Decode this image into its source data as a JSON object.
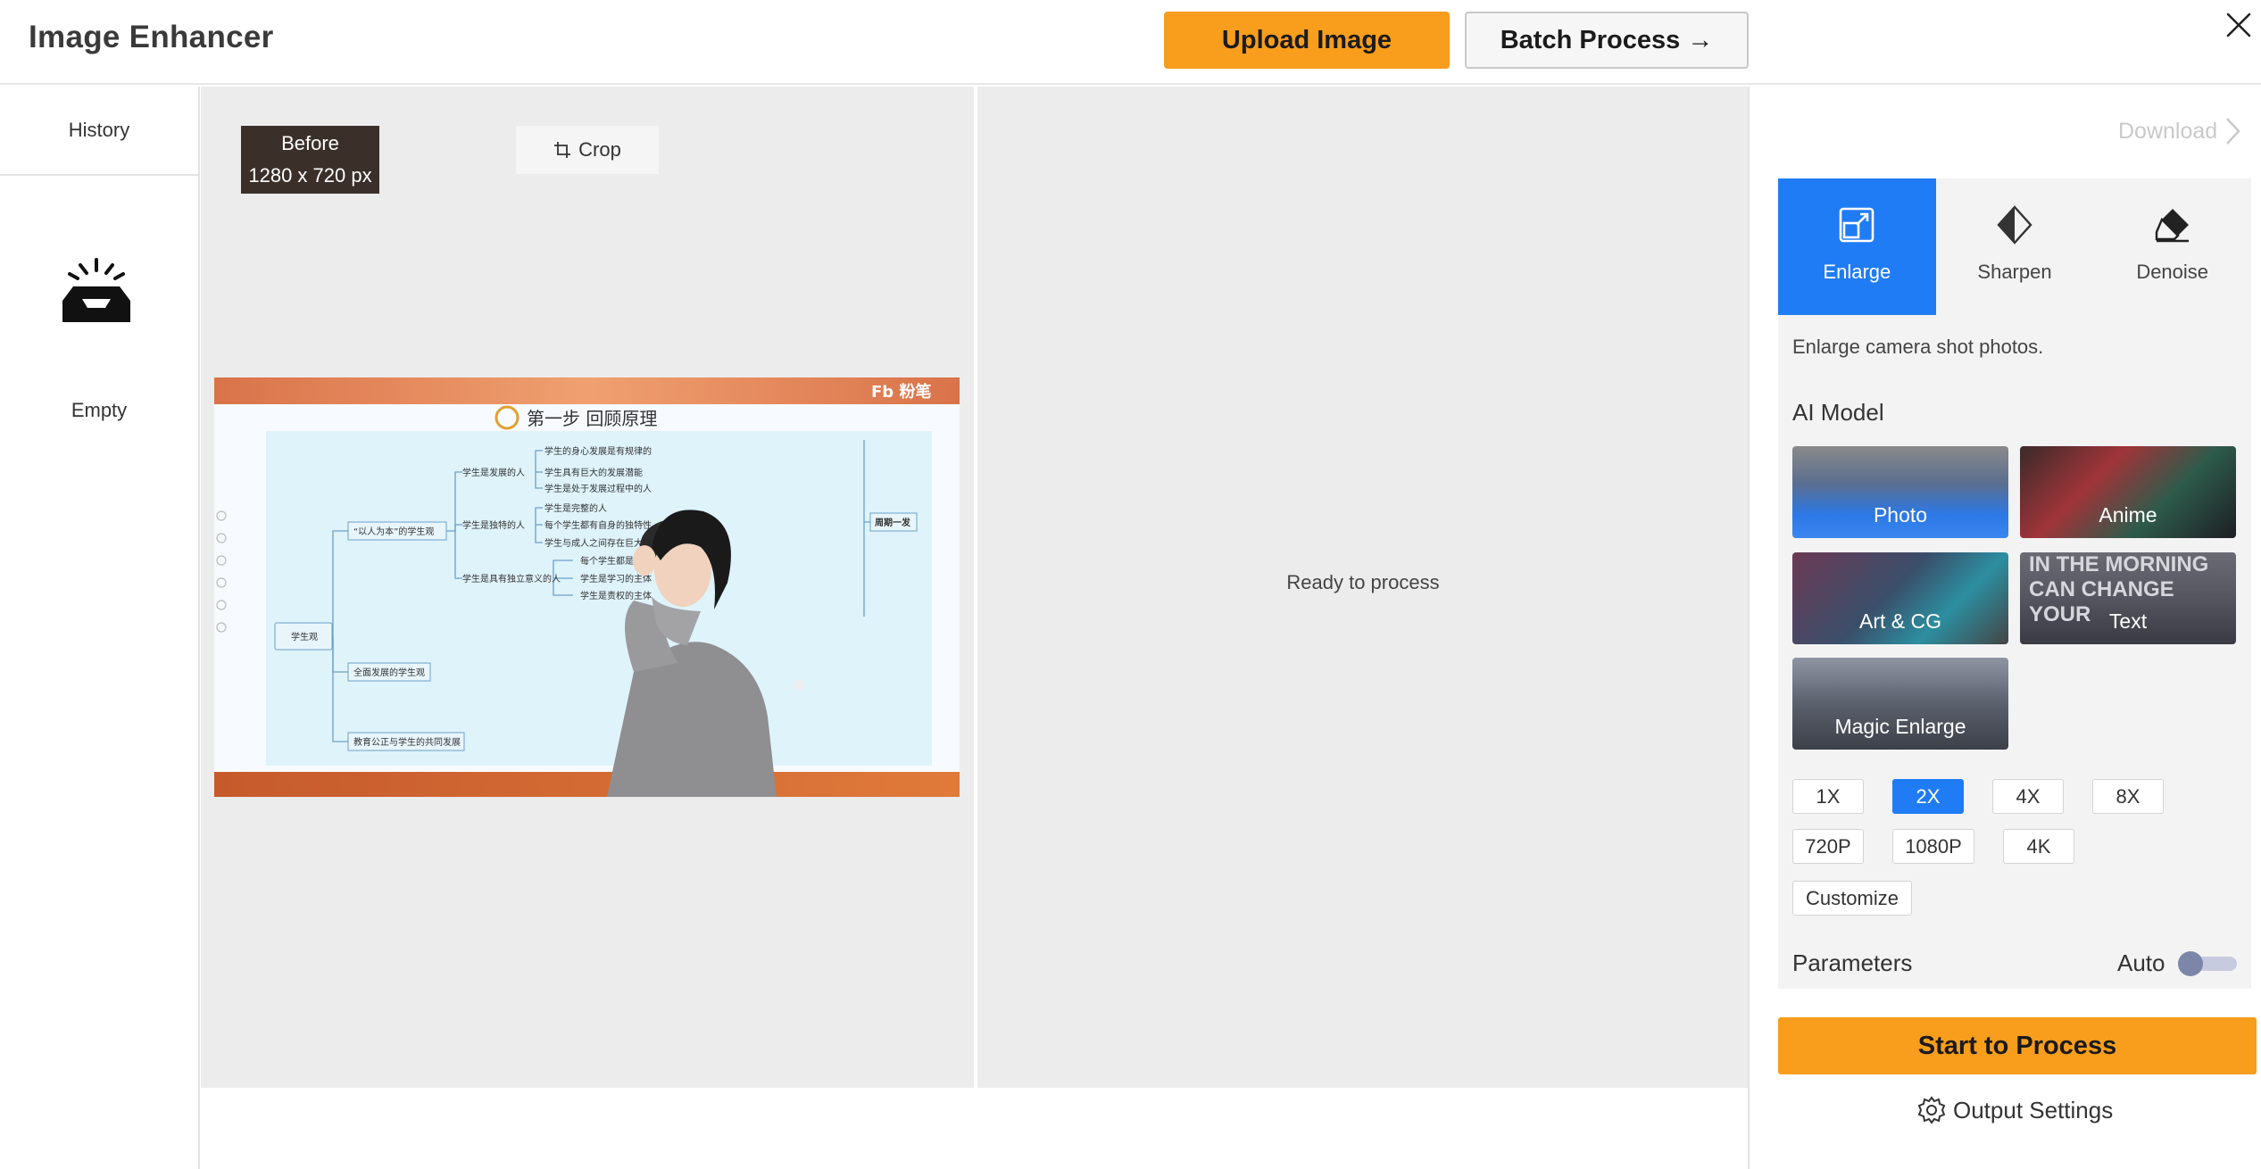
{
  "header": {
    "title": "Image Enhancer",
    "upload_label": "Upload Image",
    "batch_label": "Batch Process →",
    "close_icon": "close-icon"
  },
  "sidebar": {
    "history_label": "History",
    "empty_label": "Empty",
    "empty_icon": "empty-inbox-icon"
  },
  "canvas": {
    "before_label": "Before",
    "before_size": "1280 x 720 px",
    "crop_label": "Crop",
    "ready_text": "Ready to process",
    "preview": {
      "slide_title": "第一步  回顾原理",
      "logo": "Fb 粉笔",
      "root_node": "学生观",
      "branches": [
        "“以人为本”的学生观",
        "全面发展的学生观",
        "教育公正与学生的共同发展"
      ],
      "sub_branches": [
        "学生是发展的人",
        "学生是独特的人",
        "学生是具有独立意义的人"
      ],
      "leaves": [
        "学生的身心发展是有规律的",
        "学生具有巨大的发展潜能",
        "学生是处于发展过程中的人",
        "学生是完整的人",
        "每个学生都有自身的独特性",
        "学生与成人之间存在巨大的差异",
        "每个学生都是独立于教师的头脑之外",
        "学生是学习的主体",
        "学生是责权的主体"
      ],
      "right_node": "周期一发"
    }
  },
  "panel": {
    "download_label": "Download",
    "tabs": [
      {
        "label": "Enlarge",
        "icon": "enlarge-icon"
      },
      {
        "label": "Sharpen",
        "icon": "sharpen-icon"
      },
      {
        "label": "Denoise",
        "icon": "eraser-icon"
      }
    ],
    "description": "Enlarge camera shot photos.",
    "ai_model_title": "AI Model",
    "models": [
      "Photo",
      "Anime",
      "Art & CG",
      "Text",
      "Magic Enlarge"
    ],
    "text_card_overlay": [
      "IN THE MORNING",
      "CAN CHANGE YOUR"
    ],
    "scales": [
      "1X",
      "2X",
      "4X",
      "8X"
    ],
    "resolutions": [
      "720P",
      "1080P",
      "4K"
    ],
    "customize_label": "Customize",
    "selected_scale": "2X",
    "parameters_label": "Parameters",
    "auto_label": "Auto",
    "start_label": "Start to Process",
    "output_settings_label": "Output Settings"
  },
  "colors": {
    "accent_orange": "#f89d1c",
    "accent_blue": "#1f7cf5",
    "canvas_bg": "#ececec"
  }
}
